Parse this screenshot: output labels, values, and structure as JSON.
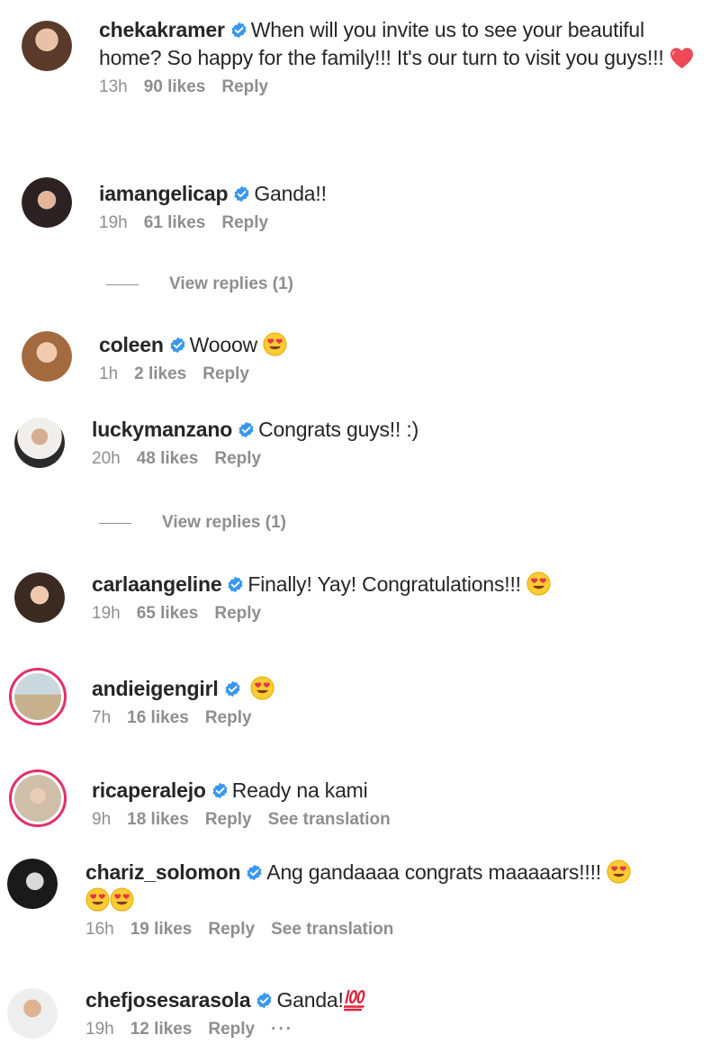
{
  "comments": [
    {
      "username": "chekakramer",
      "text": "When will you invite us to see your beautiful home? So happy for the family!!! It's our turn to visit you guys!!!",
      "emoji": "heart",
      "time": "13h",
      "likes": "90 likes",
      "reply": "Reply"
    },
    {
      "username": "iamangelicap",
      "text": "Ganda!!",
      "time": "19h",
      "likes": "61 likes",
      "reply": "Reply"
    },
    {
      "username": "coleen",
      "text": "Wooow",
      "emoji": "heart-eyes",
      "time": "1h",
      "likes": "2 likes",
      "reply": "Reply"
    },
    {
      "username": "luckymanzano",
      "text": "Congrats guys!! :)",
      "time": "20h",
      "likes": "48 likes",
      "reply": "Reply"
    },
    {
      "username": "carlaangeline",
      "text": "Finally! Yay! Congratulations!!!",
      "emoji": "heart-eyes",
      "time": "19h",
      "likes": "65 likes",
      "reply": "Reply"
    },
    {
      "username": "andieigengirl",
      "text": "",
      "emoji": "heart-eyes",
      "time": "7h",
      "likes": "16 likes",
      "reply": "Reply"
    },
    {
      "username": "ricaperalejo",
      "text": "Ready na kami",
      "time": "9h",
      "likes": "18 likes",
      "reply": "Reply",
      "translate": "See translation"
    },
    {
      "username": "chariz_solomon",
      "text": "Ang gandaaaa congrats maaaaars!!!!",
      "emoji": "heart-eyes x3",
      "time": "16h",
      "likes": "19 likes",
      "reply": "Reply",
      "translate": "See translation"
    },
    {
      "username": "chefjosesarasola",
      "text": "Ganda!",
      "emoji": "100",
      "time": "19h",
      "likes": "12 likes",
      "reply": "Reply",
      "more": "···"
    }
  ],
  "view_replies": [
    "View replies (1)",
    "View replies (1)"
  ],
  "colors": {
    "verified": "#3897f0",
    "meta_text": "#8e8e8e",
    "story_ring": "#e1306c",
    "heart": "#ed4956",
    "emoji_face": "#ffcc33"
  }
}
